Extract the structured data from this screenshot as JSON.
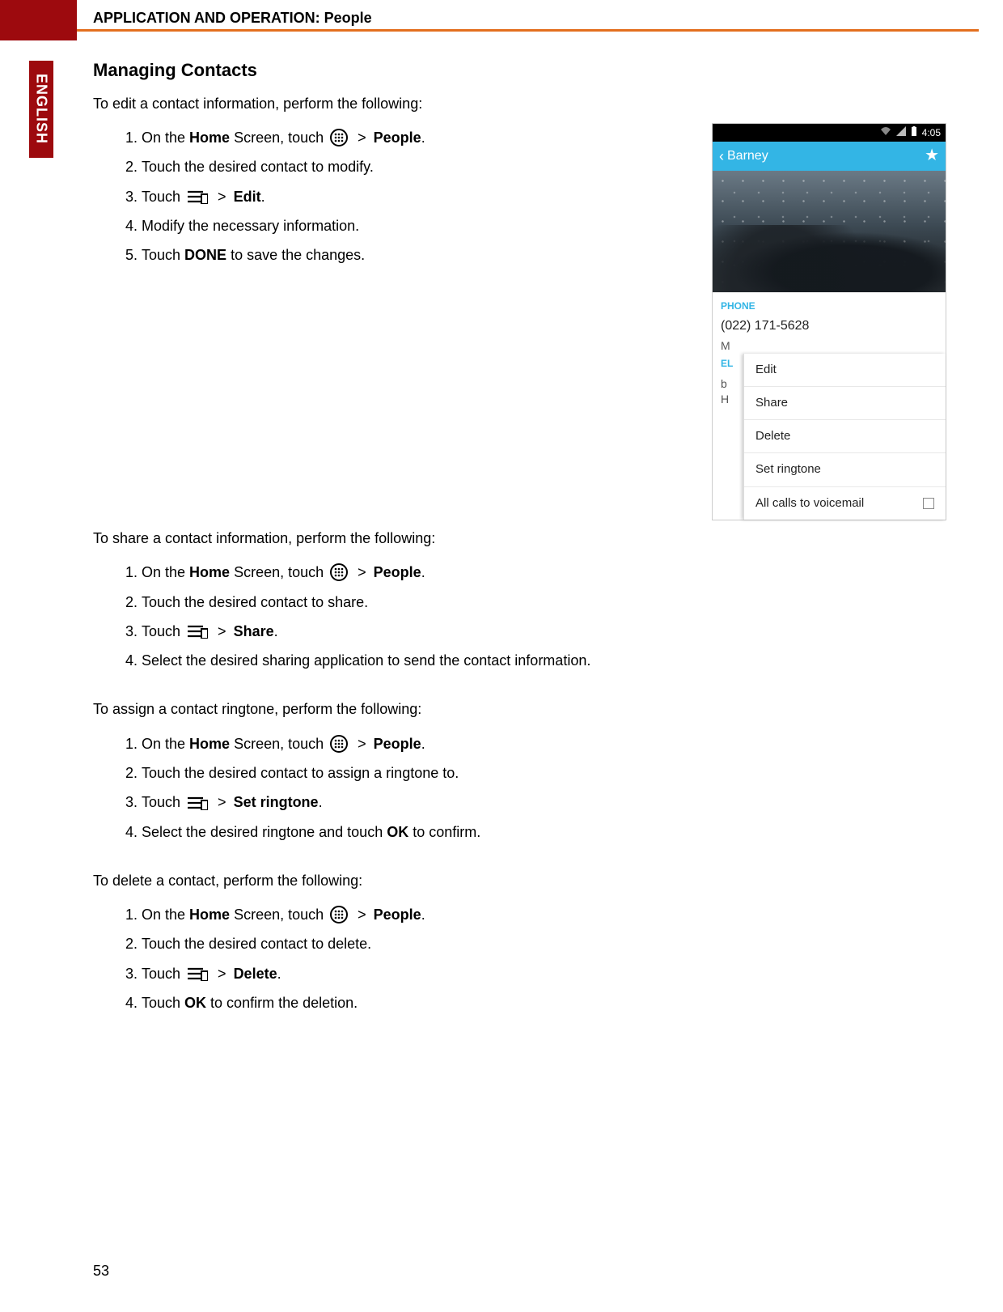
{
  "header": {
    "title": "APPLICATION AND OPERATION: People"
  },
  "lang_tab": "ENGLISH",
  "page_number": "53",
  "section_title": "Managing Contacts",
  "edit": {
    "intro": "To edit a contact information, perform the following:",
    "s1a": "On the ",
    "s1b": "Home",
    "s1c": " Screen, touch ",
    "s1d": " > ",
    "s1e": "People",
    "s1f": ".",
    "s2": "Touch the desired contact to modify.",
    "s3a": "Touch ",
    "s3b": " > ",
    "s3c": "Edit",
    "s3d": ".",
    "s4": "Modify the necessary information.",
    "s5a": "Touch ",
    "s5b": "DONE",
    "s5c": " to save the changes."
  },
  "share": {
    "intro": "To share a contact information, perform the following:",
    "s1a": "On the ",
    "s1b": "Home",
    "s1c": " Screen, touch ",
    "s1d": "  > ",
    "s1e": "People",
    "s1f": ".",
    "s2": "Touch the desired contact to share.",
    "s3a": "Touch ",
    "s3b": " > ",
    "s3c": "Share",
    "s3d": ".",
    "s4": "Select the desired sharing application to send the contact information."
  },
  "ringtone": {
    "intro": "To assign a contact ringtone, perform the following:",
    "s1a": "On the ",
    "s1b": "Home",
    "s1c": " Screen, touch ",
    "s1d": "  > ",
    "s1e": "People",
    "s1f": ".",
    "s2": "Touch the desired contact to assign a ringtone to.",
    "s3a": "Touch ",
    "s3b": " > ",
    "s3c": "Set ringtone",
    "s3d": ".",
    "s4a": "Select the desired ringtone and touch ",
    "s4b": "OK",
    "s4c": " to confirm."
  },
  "del": {
    "intro": "To delete a contact, perform the following:",
    "s1a": "On the ",
    "s1b": "Home",
    "s1c": " Screen, touch ",
    "s1d": "  > ",
    "s1e": "People",
    "s1f": ".",
    "s2": "Touch the desired contact to delete.",
    "s3a": "Touch ",
    "s3b": " > ",
    "s3c": "Delete",
    "s3d": ".",
    "s4a": "Touch ",
    "s4b": "OK",
    "s4c": " to confirm the deletion."
  },
  "screenshot": {
    "time": "4:05",
    "contact_name": "Barney",
    "phone_label": "PHONE",
    "phone_number": "(022) 171-5628",
    "left_m": "M",
    "left_el": "EL",
    "left_b": "b",
    "left_h": "H",
    "menu": {
      "edit": "Edit",
      "share": "Share",
      "delete": "Delete",
      "set_ringtone": "Set ringtone",
      "all_voicemail": "All calls to voicemail"
    }
  }
}
